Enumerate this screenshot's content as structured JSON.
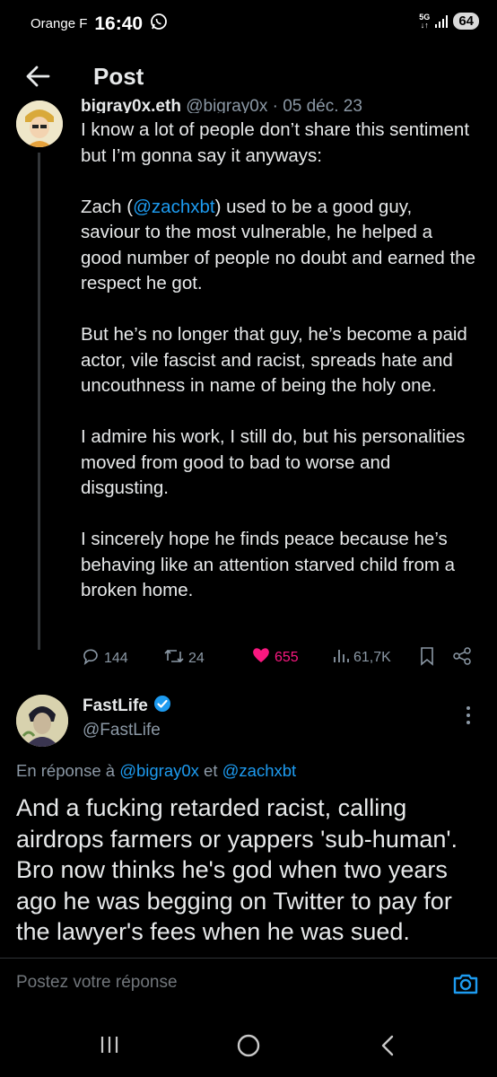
{
  "status_bar": {
    "carrier": "Orange F",
    "time": "16:40",
    "network": "5G",
    "battery": "64"
  },
  "header": {
    "title": "Post"
  },
  "quoted_tweet": {
    "author_name": "bigray0x.eth",
    "handle_date": "@bigray0x · 05 déc. 23",
    "paragraphs": [
      "I know a lot of people don’t share this sentiment but I’m gonna say it anyways:",
      "But he’s no longer that guy, he’s become a paid actor, vile fascist and racist, spreads hate and uncouthness in name of being the holy one.",
      "I admire his work, I still do, but his personalities moved from good to bad to worse and disgusting.",
      "I sincerely hope he finds peace because he’s behaving like an attention starved child from a broken home."
    ],
    "para2_before": "Zach (",
    "para2_mention": "@zachxbt",
    "para2_after": ") used to be a good guy, saviour to the most vulnerable, he helped a good number of people no doubt and earned the respect he got.",
    "stats": {
      "replies": "144",
      "reposts": "24",
      "likes": "655",
      "views": "61,7K"
    }
  },
  "reply_tweet": {
    "author_name": "FastLife",
    "handle": "@FastLife",
    "reply_prefix": "En réponse à ",
    "reply_mention_1": "@bigray0x",
    "reply_joiner": " et ",
    "reply_mention_2": "@zachxbt",
    "text": "And a fucking retarded racist, calling airdrops farmers or yappers 'sub-human'. Bro now thinks he's god when two years ago he was begging on Twitter to pay for the lawyer's fees when he was sued."
  },
  "composer": {
    "placeholder": "Postez votre réponse"
  },
  "colors": {
    "accent": "#1d9bf0",
    "like": "#f91880",
    "muted": "#8b98a5",
    "background": "#000000"
  },
  "icons": [
    "back-arrow-icon",
    "verified-badge-icon",
    "reply-icon",
    "repost-icon",
    "heart-icon",
    "views-icon",
    "bookmark-icon",
    "share-icon",
    "more-icon",
    "camera-icon",
    "recent-apps-icon",
    "home-icon",
    "back-nav-icon"
  ]
}
